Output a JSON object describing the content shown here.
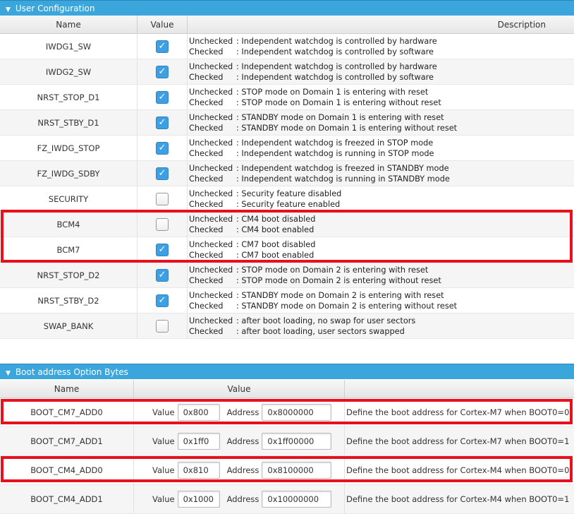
{
  "user_config": {
    "title": "User Configuration",
    "headers": {
      "name": "Name",
      "value": "Value",
      "description": "Description"
    },
    "rows": [
      {
        "name": "IWDG1_SW",
        "checked": true,
        "unchecked_desc": "Independent watchdog is controlled by hardware",
        "checked_desc": "Independent watchdog is controlled by software"
      },
      {
        "name": "IWDG2_SW",
        "checked": true,
        "unchecked_desc": "Independent watchdog is controlled by hardware",
        "checked_desc": "Independent watchdog is controlled by software"
      },
      {
        "name": "NRST_STOP_D1",
        "checked": true,
        "unchecked_desc": "STOP mode on Domain 1 is entering with reset",
        "checked_desc": "STOP mode on Domain 1 is entering without reset"
      },
      {
        "name": "NRST_STBY_D1",
        "checked": true,
        "unchecked_desc": "STANDBY mode on Domain 1 is entering with reset",
        "checked_desc": "STANDBY mode on Domain 1 is entering without reset"
      },
      {
        "name": "FZ_IWDG_STOP",
        "checked": true,
        "unchecked_desc": "Independent watchdog is freezed in STOP mode",
        "checked_desc": "Independent watchdog is running in STOP mode"
      },
      {
        "name": "FZ_IWDG_SDBY",
        "checked": true,
        "unchecked_desc": "Independent watchdog is freezed in STANDBY mode",
        "checked_desc": "Independent watchdog is running in STANDBY mode"
      },
      {
        "name": "SECURITY",
        "checked": false,
        "unchecked_desc": "Security feature disabled",
        "checked_desc": "Security feature enabled"
      },
      {
        "name": "BCM4",
        "checked": false,
        "unchecked_desc": "CM4 boot disabled",
        "checked_desc": "CM4 boot enabled"
      },
      {
        "name": "BCM7",
        "checked": true,
        "unchecked_desc": "CM7 boot disabled",
        "checked_desc": "CM7 boot enabled"
      },
      {
        "name": "NRST_STOP_D2",
        "checked": true,
        "unchecked_desc": "STOP mode on Domain 2 is entering with reset",
        "checked_desc": "STOP mode on Domain 2 is entering without reset"
      },
      {
        "name": "NRST_STBY_D2",
        "checked": true,
        "unchecked_desc": "STANDBY mode on Domain 2 is entering with reset",
        "checked_desc": "STANDBY mode on Domain 2 is entering without reset"
      },
      {
        "name": "SWAP_BANK",
        "checked": false,
        "unchecked_desc": "after boot loading, no swap for user sectors",
        "checked_desc": "after boot loading, user sectors swapped"
      }
    ],
    "unchecked_label": "Unchecked",
    "checked_label": "Checked",
    "sep": ":"
  },
  "boot": {
    "title": "Boot address Option Bytes",
    "headers": {
      "name": "Name",
      "value": "Value"
    },
    "value_label": "Value",
    "address_label": "Address",
    "rows": [
      {
        "name": "BOOT_CM7_ADD0",
        "value": "0x800",
        "address": "0x8000000",
        "desc": "Define the boot address for Cortex-M7 when BOOT0=0"
      },
      {
        "name": "BOOT_CM7_ADD1",
        "value": "0x1ff0",
        "address": "0x1ff00000",
        "desc": "Define the boot address for Cortex-M7 when BOOT0=1"
      },
      {
        "name": "BOOT_CM4_ADD0",
        "value": "0x810",
        "address": "0x8100000",
        "desc": "Define the boot address for Cortex-M4 when BOOT0=0"
      },
      {
        "name": "BOOT_CM4_ADD1",
        "value": "0x1000",
        "address": "0x10000000",
        "desc": "Define the boot address for Cortex-M4 when BOOT0=1"
      }
    ]
  },
  "colors": {
    "accent": "#3ba6dc",
    "highlight": "#e8101c"
  }
}
